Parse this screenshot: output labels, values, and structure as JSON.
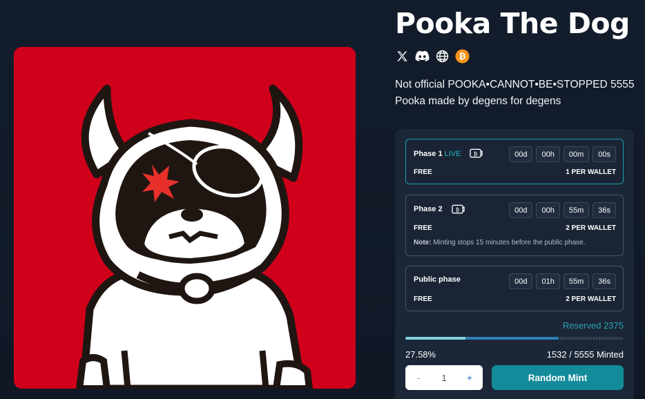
{
  "collection": {
    "title": "Pooka The Dog",
    "description_line1": "Not official POOKA•CANNOT•BE•STOPPED 5555",
    "description_line2": "Pooka made by degens for degens"
  },
  "socials": [
    {
      "icon": "x-twitter-icon"
    },
    {
      "icon": "discord-icon"
    },
    {
      "icon": "globe-icon"
    },
    {
      "icon": "bitcoin-icon"
    }
  ],
  "phases": [
    {
      "name": "Phase 1",
      "status": "LIVE",
      "price": "FREE",
      "limit": "1 PER WALLET",
      "timer": {
        "d": "00d",
        "h": "00h",
        "m": "00m",
        "s": "00s"
      }
    },
    {
      "name": "Phase 2",
      "price": "FREE",
      "limit": "2 PER WALLET",
      "note_label": "Note:",
      "note_text": "Minting stops 15 minutes before the public phase.",
      "timer": {
        "d": "00d",
        "h": "00h",
        "m": "55m",
        "s": "36s"
      }
    },
    {
      "name": "Public phase",
      "price": "FREE",
      "limit": "2 PER WALLET",
      "timer": {
        "d": "00d",
        "h": "01h",
        "m": "55m",
        "s": "36s"
      }
    }
  ],
  "mint": {
    "reserved_label": "Reserved 2375",
    "minted_fraction": 0.2758,
    "reserved_fraction": 0.7033,
    "percent_label": "27.58%",
    "minted_label": "1532 / 5555 Minted",
    "quantity": "1",
    "minus_label": "-",
    "plus_label": "+",
    "button_label": "Random Mint"
  },
  "colors": {
    "background": "#131c2b",
    "accent": "#138b9a",
    "live": "#1eb6c4",
    "art_background": "#d0001b",
    "progress_minted": "#7fd3e0",
    "progress_reserved": "#2e7fb5"
  }
}
